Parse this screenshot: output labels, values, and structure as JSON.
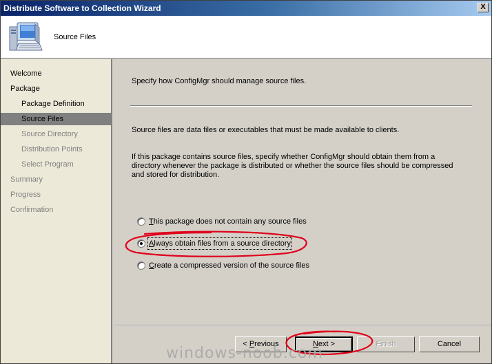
{
  "window": {
    "title": "Distribute Software to Collection Wizard",
    "close_label": "X"
  },
  "header": {
    "title": "Source Files",
    "icon": "computer-icon"
  },
  "sidebar": {
    "items": [
      {
        "label": "Welcome",
        "level": 1,
        "state": "normal"
      },
      {
        "label": "Package",
        "level": 1,
        "state": "normal"
      },
      {
        "label": "Package Definition",
        "level": 2,
        "state": "normal"
      },
      {
        "label": "Source Files",
        "level": 2,
        "state": "selected"
      },
      {
        "label": "Source Directory",
        "level": 2,
        "state": "muted"
      },
      {
        "label": "Distribution Points",
        "level": 2,
        "state": "muted"
      },
      {
        "label": "Select Program",
        "level": 2,
        "state": "muted"
      },
      {
        "label": "Summary",
        "level": 1,
        "state": "muted"
      },
      {
        "label": "Progress",
        "level": 1,
        "state": "muted"
      },
      {
        "label": "Confirmation",
        "level": 1,
        "state": "muted"
      }
    ]
  },
  "main": {
    "instruction": "Specify how ConfigMgr should manage source files.",
    "description": "Source files are data files or executables that must be made available to clients.",
    "explanation": [
      "If this package contains source files, specify whether ConfigMgr should obtain them from a",
      "directory whenever the package is distributed or whether the source files should be compressed",
      "and stored for distribution."
    ],
    "options": [
      {
        "mnemonic": "T",
        "rest": "his package does not contain any source files",
        "checked": false
      },
      {
        "mnemonic": "A",
        "rest": "lways obtain files from a source directory",
        "checked": true
      },
      {
        "mnemonic": "C",
        "rest": "reate a compressed version of the source files",
        "checked": false
      }
    ]
  },
  "buttons": {
    "previous": {
      "prefix": "< ",
      "mnemonic": "P",
      "rest": "revious"
    },
    "next": {
      "mnemonic": "N",
      "rest": "ext >"
    },
    "finish": {
      "mnemonic": "F",
      "rest": "inish"
    },
    "cancel": {
      "label": "Cancel"
    }
  },
  "watermark": "windows-noob.com",
  "colors": {
    "title_bar_start": "#0a246a",
    "title_bar_end": "#a6caf0",
    "selected_item": "#808080",
    "annotation_red": "#e0001b"
  }
}
